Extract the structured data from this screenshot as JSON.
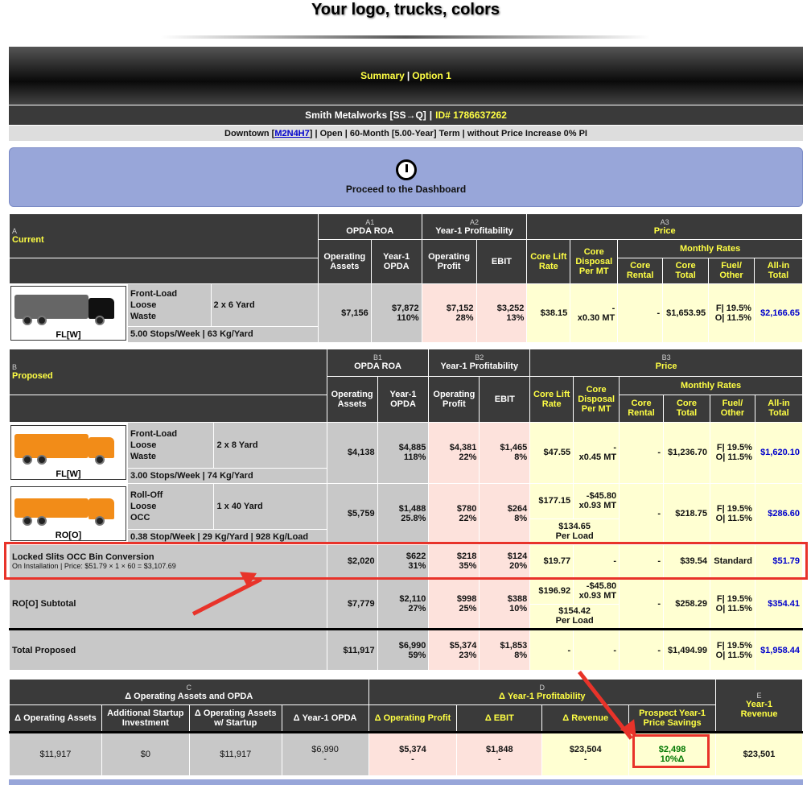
{
  "header": {
    "title": "Your logo, trucks, colors"
  },
  "banner": {
    "summary": "Summary",
    "separator": "|",
    "option": "Option 1"
  },
  "customer": {
    "name": "Smith Metalworks [SS→Q]",
    "separator": "|",
    "id": "ID# 1786637262"
  },
  "terms": {
    "prefix": "Downtown [",
    "code": "M2N4H7",
    "suffix": "] | Open | 60-Month [5.00-Year] Term | without Price Increase 0% PI"
  },
  "dashboard": {
    "label": "Proceed to the Dashboard",
    "icon": "gauge-icon"
  },
  "sectionA": {
    "letter": "A",
    "title": "Current",
    "groups": [
      {
        "code": "A1",
        "label": "OPDA ROA"
      },
      {
        "code": "A2",
        "label": "Year-1 Profitability"
      },
      {
        "code": "A3",
        "label": "Price"
      }
    ],
    "cols": {
      "operating_assets": "Operating Assets",
      "year1_opda": "Year-1 OPDA",
      "operating_profit": "Operating Profit",
      "ebit": "EBIT",
      "core_lift": "Core Lift Rate",
      "core_disposal": "Core Disposal Per MT",
      "monthly": "Monthly Rates",
      "core_rental": "Core Rental",
      "core_total": "Core Total",
      "fuel_other": "Fuel/ Other",
      "all_in": "All-in Total"
    },
    "row": {
      "truck_label": "FL[W]",
      "desc1": "Front-Load",
      "desc2": "Loose",
      "desc3": "Waste",
      "size": "2 x 6 Yard",
      "stops": "5.00 Stops/Week | 63 Kg/Yard",
      "oa": "$7,156",
      "opda": "$7,872",
      "opda_pct": "110%",
      "op": "$7,152",
      "op_pct": "28%",
      "ebit": "$3,252",
      "ebit_pct": "13%",
      "lift": "$38.15",
      "disp1": "-",
      "disp2": "x0.30 MT",
      "rental": "-",
      "core_total": "$1,653.95",
      "fuel": "F| 19.5%",
      "other": "O| 11.5%",
      "allin": "$2,166.65"
    }
  },
  "sectionB": {
    "letter": "B",
    "title": "Proposed",
    "groups": [
      {
        "code": "B1",
        "label": "OPDA ROA"
      },
      {
        "code": "B2",
        "label": "Year-1 Profitability"
      },
      {
        "code": "B3",
        "label": "Price"
      }
    ],
    "rows": [
      {
        "truck_label": "FL[W]",
        "desc1": "Front-Load",
        "desc2": "Loose",
        "desc3": "Waste",
        "size": "2 x 8 Yard",
        "stops": "3.00 Stops/Week | 74 Kg/Yard",
        "oa": "$4,138",
        "opda": "$4,885",
        "opda_pct": "118%",
        "op": "$4,381",
        "op_pct": "22%",
        "ebit": "$1,465",
        "ebit_pct": "8%",
        "lift": "$47.55",
        "disp1": "-",
        "disp2": "x0.45 MT",
        "rental": "-",
        "core_total": "$1,236.70",
        "fuel": "F| 19.5%",
        "other": "O| 11.5%",
        "allin": "$1,620.10"
      },
      {
        "truck_label": "RO[O]",
        "desc1": "Roll-Off",
        "desc2": "Loose",
        "desc3": "OCC",
        "size": "1 x 40 Yard",
        "stops": "0.38 Stop/Week | 29 Kg/Yard | 928 Kg/Load",
        "oa": "$5,759",
        "opda": "$1,488",
        "opda_pct": "25.8%",
        "op": "$780",
        "op_pct": "22%",
        "ebit": "$264",
        "ebit_pct": "8%",
        "lift": "$177.15",
        "disp1": "-$45.80",
        "disp2": "x0.93 MT",
        "perload1": "$134.65",
        "perload2": "Per Load",
        "rental": "-",
        "core_total": "$218.75",
        "fuel": "F| 19.5%",
        "other": "O| 11.5%",
        "allin": "$286.60"
      }
    ],
    "locked": {
      "title": "Locked Slits OCC Bin Conversion",
      "detail": "On Installation | Price: $51.79 × 1 × 60 = $3,107.69",
      "oa": "$2,020",
      "opda": "$622",
      "opda_pct": "31%",
      "op": "$218",
      "op_pct": "35%",
      "ebit": "$124",
      "ebit_pct": "20%",
      "lift": "$19.77",
      "disp": "-",
      "rental": "-",
      "core_total": "$39.54",
      "fuel": "Standard",
      "allin": "$51.79"
    },
    "subtotal": {
      "label": "RO[O] Subtotal",
      "oa": "$7,779",
      "opda": "$2,110",
      "opda_pct": "27%",
      "op": "$998",
      "op_pct": "25%",
      "ebit": "$388",
      "ebit_pct": "10%",
      "lift": "$196.92",
      "disp1": "-$45.80",
      "disp2": "x0.93 MT",
      "perload1": "$154.42",
      "perload2": "Per Load",
      "rental": "-",
      "core_total": "$258.29",
      "fuel": "F| 19.5%",
      "other": "O| 11.5%",
      "allin": "$354.41"
    },
    "total": {
      "label": "Total Proposed",
      "oa": "$11,917",
      "opda": "$6,990",
      "opda_pct": "59%",
      "op": "$5,374",
      "op_pct": "23%",
      "ebit": "$1,853",
      "ebit_pct": "8%",
      "lift": "-",
      "disp": "-",
      "rental": "-",
      "core_total": "$1,494.99",
      "fuel": "F| 19.5%",
      "other": "O| 11.5%",
      "allin": "$1,958.44"
    }
  },
  "sectionC": {
    "c_code": "C",
    "c_label": "Δ Operating Assets and OPDA",
    "d_code": "D",
    "d_label": "Δ Year-1 Profitability",
    "e_code": "E",
    "e_label1": "Year-1",
    "e_label2": "Revenue",
    "cols": [
      "Δ Operating Assets",
      "Additional Startup Investment",
      "Δ Operating Assets w/ Startup",
      "Δ Year-1 OPDA",
      "Δ Operating Profit",
      "Δ EBIT",
      "Δ Revenue",
      "Prospect Year-1 Price Savings"
    ],
    "values": {
      "doa": "$11,917",
      "startup": "$0",
      "doa_startup": "$11,917",
      "dopda": "$6,990",
      "dopda_sub": "-",
      "dop": "$5,374",
      "dop_sub": "-",
      "debit": "$1,848",
      "debit_sub": "-",
      "drev": "$23,504",
      "drev_sub": "-",
      "savings": "$2,498",
      "savings_pct": "10%Δ",
      "revenue": "$23,501"
    }
  }
}
